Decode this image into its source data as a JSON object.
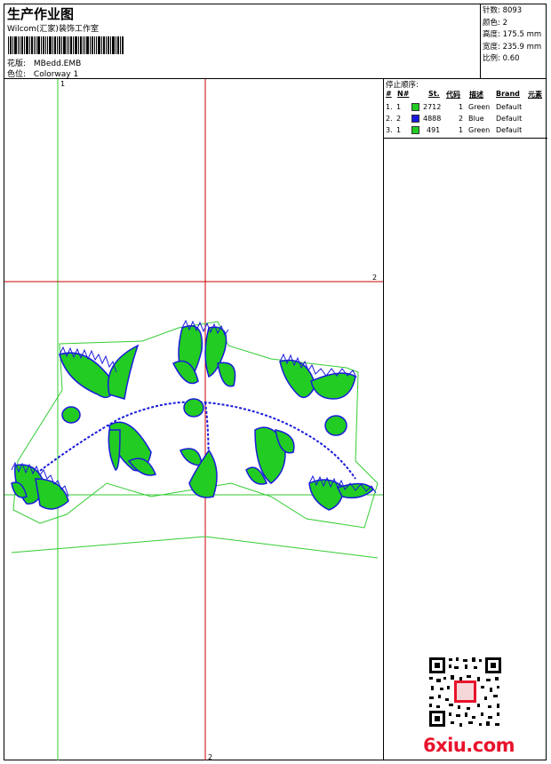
{
  "header": {
    "title": "生产作业图",
    "studio": "Wilcom(汇家)装饰工作室",
    "design_label": "花版:",
    "design_file": "MBedd.EMB",
    "colorway_label": "色位:",
    "colorway": "Colorway 1"
  },
  "stats": [
    {
      "label": "针数:",
      "value": "8093"
    },
    {
      "label": "颜色:",
      "value": "2"
    },
    {
      "label": "高度:",
      "value": "175.5 mm"
    },
    {
      "label": "宽度:",
      "value": "235.9 mm"
    },
    {
      "label": "比例:",
      "value": "0.60"
    }
  ],
  "stop_sequence": {
    "title": "停止顺序:",
    "columns": [
      "#",
      "N#",
      "St.",
      "代码",
      "描述",
      "Brand",
      "元素"
    ],
    "rows": [
      {
        "index": "1.",
        "needle": "1",
        "color": "#22cc22",
        "stitches": "2712",
        "code": "1",
        "desc": "Green",
        "brand": "Default"
      },
      {
        "index": "2.",
        "needle": "2",
        "color": "#1a1adc",
        "stitches": "4888",
        "code": "2",
        "desc": "Blue",
        "brand": "Default"
      },
      {
        "index": "3.",
        "needle": "1",
        "color": "#22cc22",
        "stitches": "491",
        "code": "1",
        "desc": "Green",
        "brand": "Default"
      }
    ]
  },
  "canvas": {
    "axis_marks": {
      "top": "1",
      "right": "2",
      "bottom": "2"
    },
    "colors": {
      "green": "#22cc22",
      "blue": "#1a1adc",
      "red": "#cc0000",
      "outline": "#33cc33"
    }
  },
  "watermark": "6xiu.com"
}
